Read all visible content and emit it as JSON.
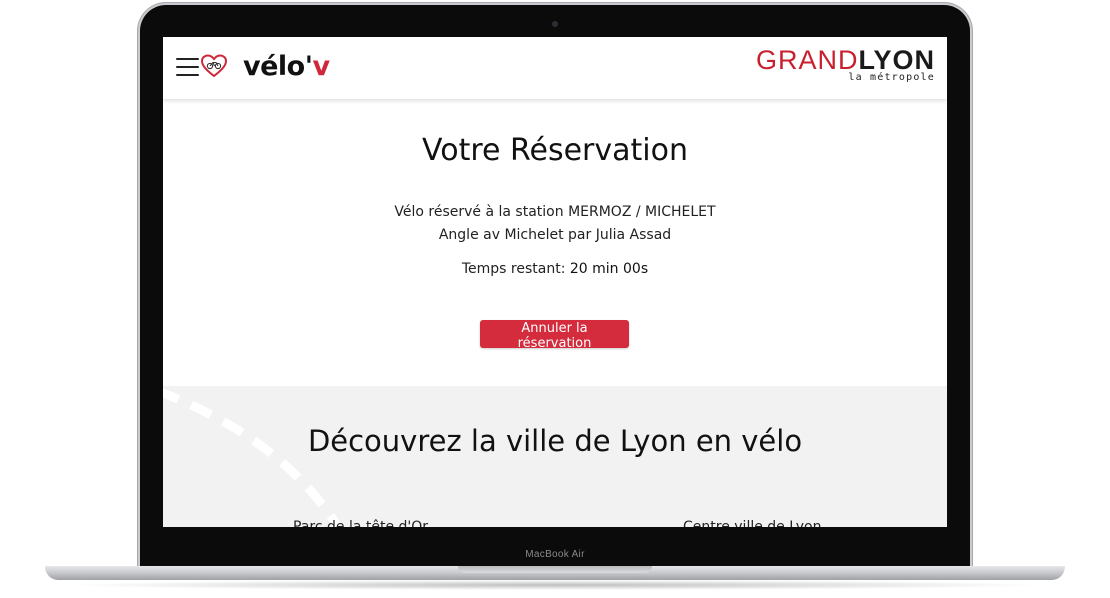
{
  "device": {
    "label": "MacBook Air"
  },
  "header": {
    "menu_icon": "hamburger-menu-icon",
    "app_icon": "heart-bike-icon",
    "app_logo_main": "vélo'",
    "app_logo_accent": "v",
    "partner_logo_part1": "GRAND",
    "partner_logo_part2": "LYON",
    "partner_logo_sub": "la métropole"
  },
  "reservation": {
    "title": "Votre Réservation",
    "station_line1": "Vélo réservé à la station MERMOZ / MICHELET",
    "station_line2": "Angle av Michelet par Julia Assad",
    "time_label": "Temps restant:",
    "time_value": "20 min 00s",
    "cancel_label": "Annuler la réservation"
  },
  "discover": {
    "title": "Découvrez la ville de Lyon en vélo",
    "card_left_peek": "Parc de la tête d'Or",
    "card_right_peek": "Centre ville de Lyon"
  },
  "colors": {
    "accent_red": "#d42c3c",
    "brand_red": "#c8202f",
    "section_bg": "#f2f2f2"
  }
}
